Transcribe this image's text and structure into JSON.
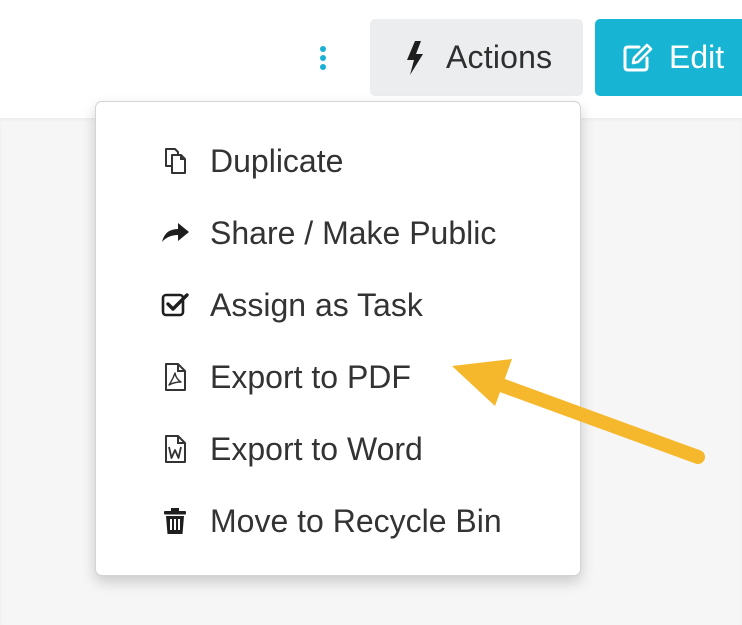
{
  "colors": {
    "kebab_dot": "#1ab0d6",
    "actions_bg": "#ebedef",
    "edit_bg": "#17b5d3",
    "arrow": "#f5b82c",
    "menu_text": "#333333",
    "content_bg": "#f6f6f6"
  },
  "toolbar": {
    "more_icon": "vertical-ellipsis-icon",
    "actions": {
      "icon": "bolt-icon",
      "label": "Actions"
    },
    "edit": {
      "icon": "pencil-square-icon",
      "label": "Edit"
    }
  },
  "menu": {
    "items": [
      {
        "icon": "copy-icon",
        "label": "Duplicate"
      },
      {
        "icon": "share-icon",
        "label": "Share / Make Public"
      },
      {
        "icon": "check-square-icon",
        "label": "Assign as Task"
      },
      {
        "icon": "pdf-file-icon",
        "label": "Export to PDF"
      },
      {
        "icon": "word-file-icon",
        "label": "Export to Word"
      },
      {
        "icon": "trash-icon",
        "label": "Move to Recycle Bin"
      }
    ]
  },
  "annotation": {
    "icon": "arrow-icon"
  }
}
